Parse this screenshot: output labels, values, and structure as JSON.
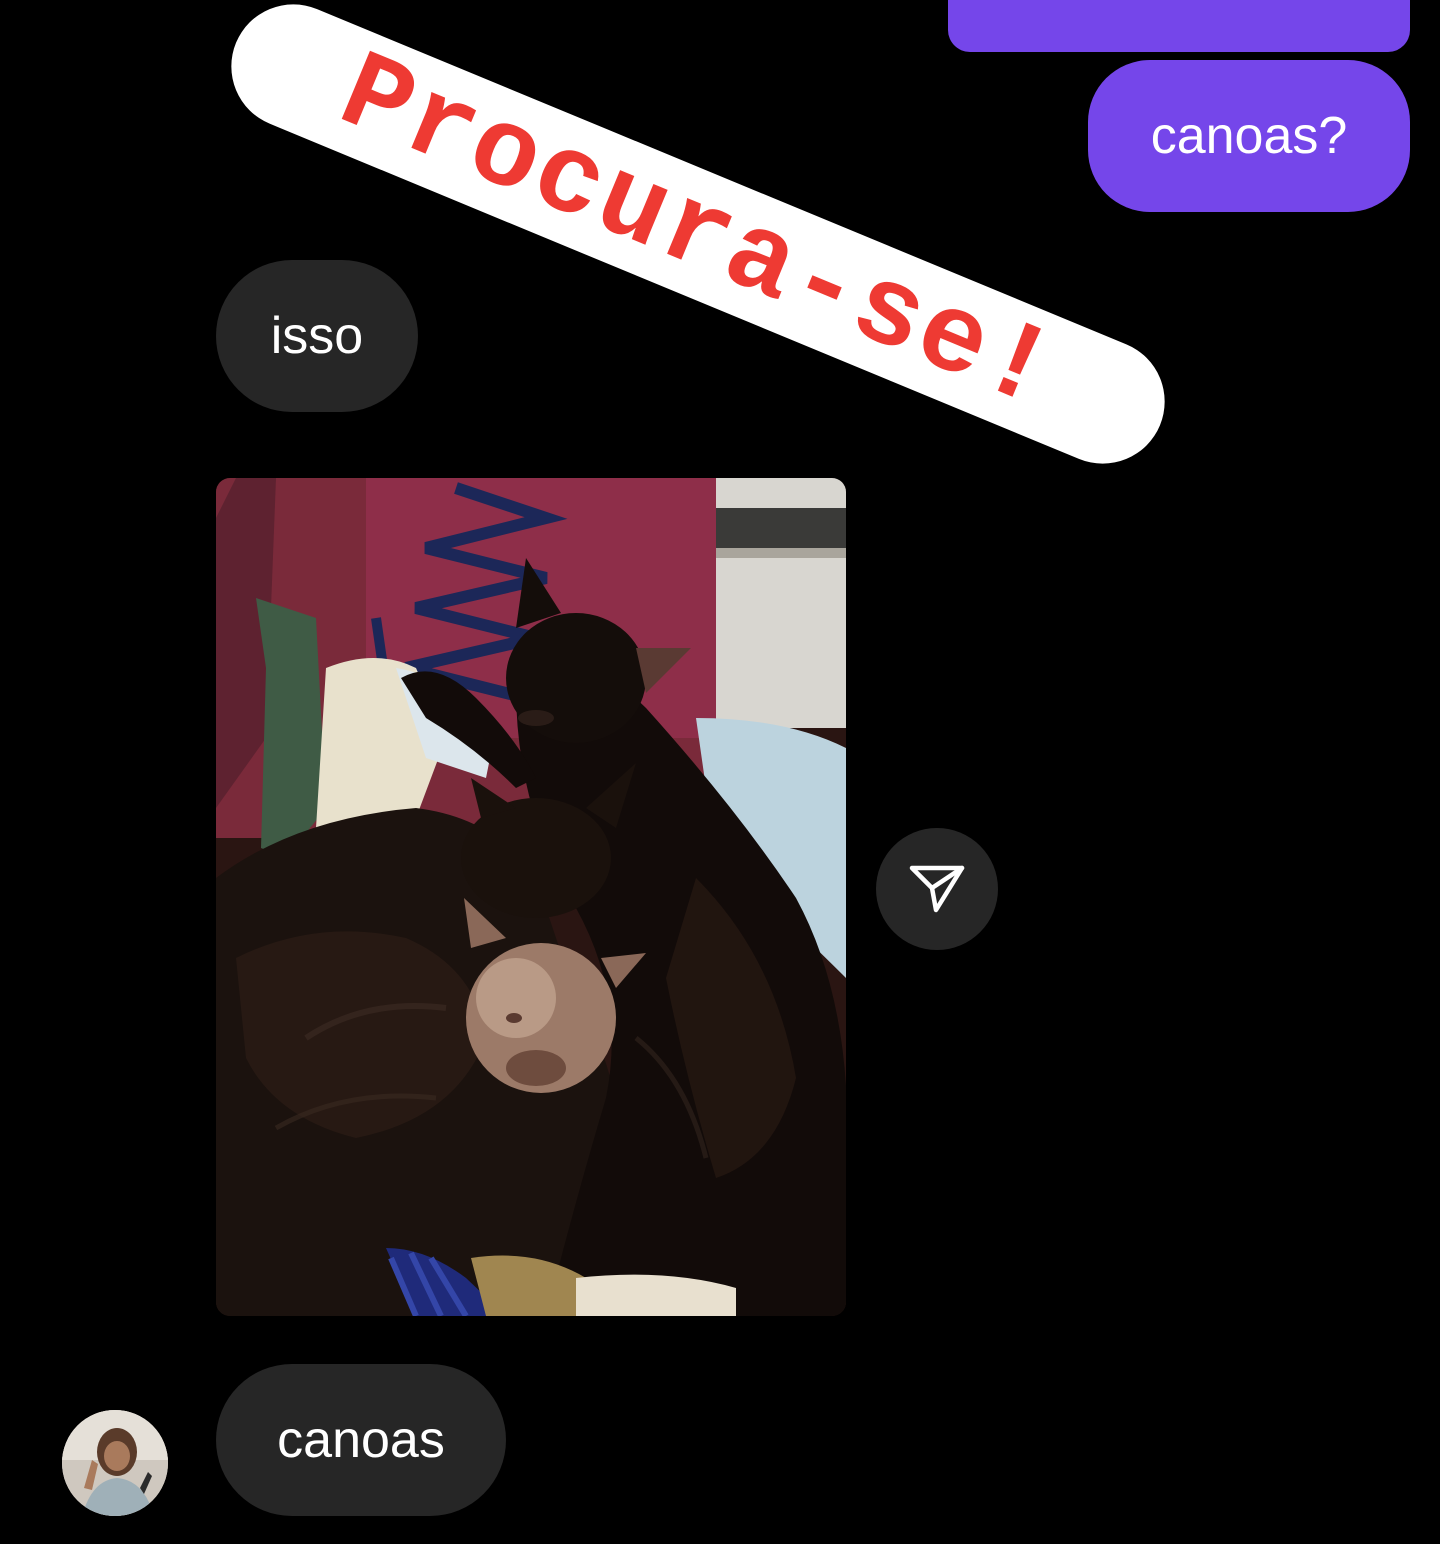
{
  "messages": {
    "sent_top": "",
    "sent_canoas": "canoas?",
    "received_isso": "isso",
    "received_canoas": "canoas",
    "bottom_partial": ""
  },
  "photo": {
    "subject": "three cats curled together"
  },
  "sticker": {
    "text": "Procura-se!"
  },
  "icons": {
    "share": "paper-plane-icon",
    "avatar": "user-avatar"
  },
  "colors": {
    "background": "#000000",
    "sent_bubble": "#7546ea",
    "received_bubble": "#262626",
    "sticker_text": "#ee3a33",
    "sticker_bg": "#ffffff"
  }
}
